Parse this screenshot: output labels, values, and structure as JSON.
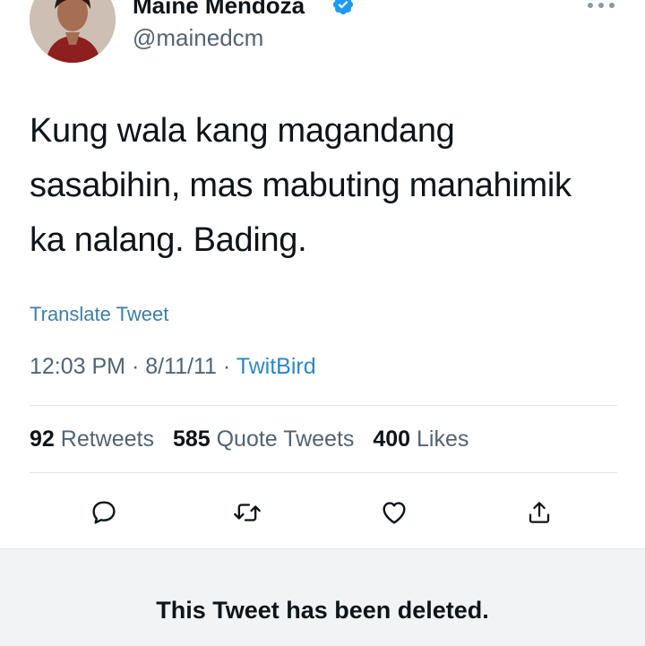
{
  "author": {
    "display_name": "Maine Mendoza",
    "handle": "@mainedcm",
    "verified": true
  },
  "tweet": {
    "text_line1": "Kung wala kang magandang",
    "text_line2": "sasabihin, mas mabuting manahimik",
    "text_line3": "ka nalang. Bading.",
    "translate_label": "Translate Tweet",
    "time": "12:03 PM",
    "separator": "·",
    "date": "8/11/11",
    "source": "TwitBird"
  },
  "stats": {
    "retweets_count": "92",
    "retweets_label": "Retweets",
    "quotes_count": "585",
    "quotes_label": "Quote Tweets",
    "likes_count": "400",
    "likes_label": "Likes"
  },
  "actions": [
    "reply-icon",
    "retweet-icon",
    "like-icon",
    "share-icon"
  ],
  "banner": {
    "deleted_text": "This Tweet has been deleted."
  },
  "colors": {
    "link": "#2f86c5",
    "verified": "#1d9bf0",
    "muted": "#536471",
    "banner_bg": "#f2f3f5"
  }
}
